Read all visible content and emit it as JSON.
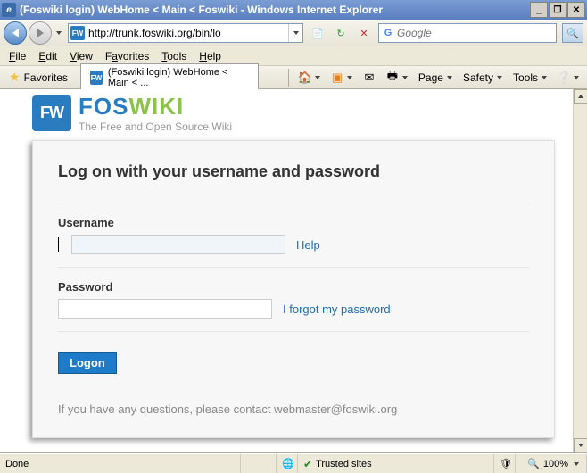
{
  "window": {
    "title": "(Foswiki login) WebHome < Main < Foswiki - Windows Internet Explorer"
  },
  "navbar": {
    "url": "http://trunk.foswiki.org/bin/lo",
    "search_placeholder": "Google"
  },
  "menu": {
    "file": "File",
    "edit": "Edit",
    "view": "View",
    "favorites": "Favorites",
    "tools": "Tools",
    "help": "Help"
  },
  "favbar": {
    "favorites": "Favorites",
    "tab_label": "(Foswiki login) WebHome < Main < ...",
    "page": "Page",
    "safety": "Safety",
    "tools": "Tools"
  },
  "logo": {
    "badge": "FW",
    "name_fos": "FOS",
    "name_wiki": "WIKI",
    "tagline": "The Free and Open Source Wiki"
  },
  "login": {
    "heading": "Log on with your username and password",
    "username_label": "Username",
    "username_help": "Help",
    "password_label": "Password",
    "forgot": "I forgot my password",
    "logon_btn": "Logon",
    "footer": "If you have any questions, please contact webmaster@foswiki.org"
  },
  "status": {
    "done": "Done",
    "trusted": "Trusted sites",
    "zoom": "100%"
  }
}
